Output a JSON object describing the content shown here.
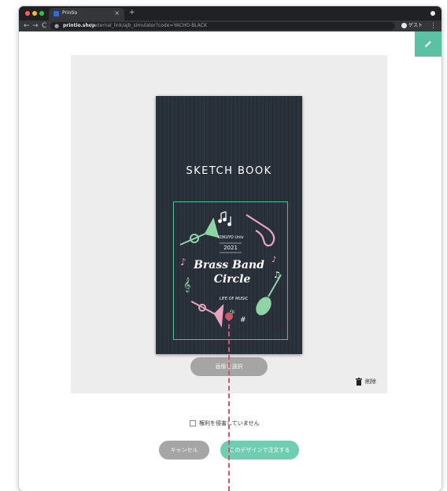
{
  "browser": {
    "tab_title": "Printio",
    "tab_close": "×",
    "new_tab": "+",
    "nav": {
      "back": "←",
      "forward": "→",
      "reload": "C"
    },
    "url_host": "printio.shop",
    "url_path": "/external_link/ajb_simulator?code=YACHO-BLACK",
    "profile_label": "ゲスト",
    "menu": "⋮"
  },
  "editor": {
    "cover_title": "SKETCH BOOK",
    "artwork": {
      "org": "KOKUYO Univ",
      "year": "2021",
      "line1": "Brass Band",
      "line2": "Circle",
      "tagline": "LIFE OF MUSIC"
    },
    "select_image_label": "画像を選択",
    "delete_label": "削除"
  },
  "form": {
    "rights_checkbox_label": "権利を侵害していません",
    "rights_checked": false,
    "cancel_label": "キャンセル",
    "order_label": "このデザインで注文する"
  },
  "colors": {
    "accent": "#5cc0a4",
    "order_button": "#6fceb2",
    "cover": "#262e38",
    "annotation": "#d2566a"
  }
}
